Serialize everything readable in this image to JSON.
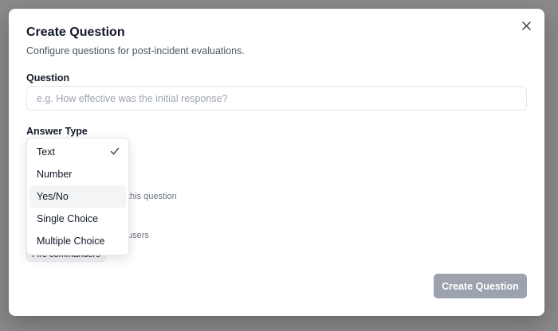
{
  "modal": {
    "title": "Create Question",
    "subtitle": "Configure questions for post-incident evaluations.",
    "close_icon": "x-icon"
  },
  "question": {
    "label": "Question",
    "value": "",
    "placeholder": "e.g. How effective was the initial response?"
  },
  "answer_type": {
    "label": "Answer Type",
    "selected": "Text",
    "options": [
      "Text",
      "Number",
      "Yes/No",
      "Single Choice",
      "Multiple Choice"
    ],
    "hovered": "Yes/No"
  },
  "obscured": {
    "required_hint": "this question",
    "audience_hint": "users",
    "audience_chip": "Fire commanders"
  },
  "footer": {
    "submit_label": "Create Question"
  },
  "colors": {
    "backdrop": "#8a8a8a",
    "submit_disabled": "#9ca3af",
    "hover_row": "#f3f4f6"
  }
}
